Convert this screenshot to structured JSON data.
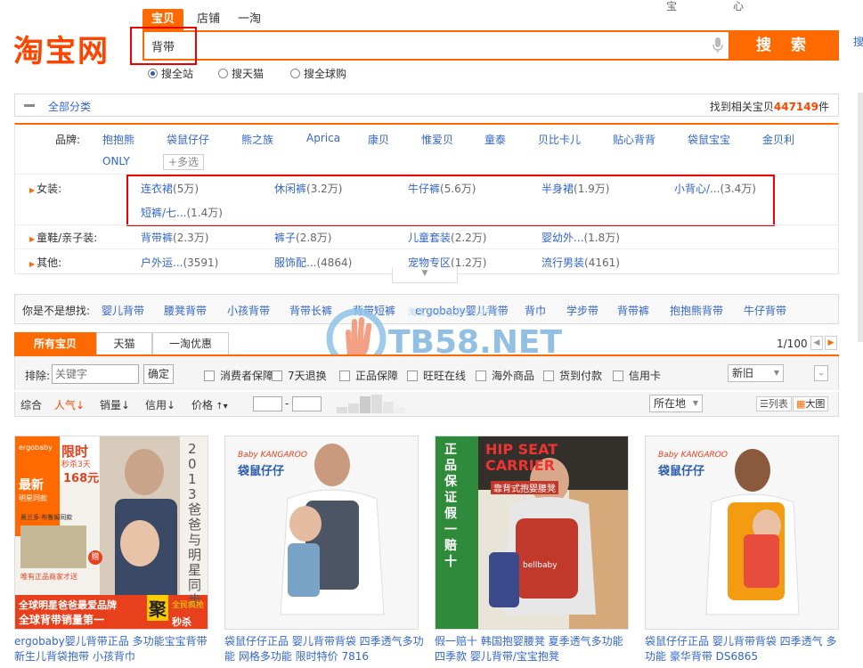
{
  "header": {
    "logo": "淘宝网",
    "top_faint_left": "宝",
    "top_faint_right": "心",
    "search_tabs": [
      "宝贝",
      "店铺",
      "一淘"
    ],
    "search_value": "背带",
    "search_button": "搜 索",
    "radios": [
      "搜全站",
      "搜天猫",
      "搜全球购"
    ],
    "right_edge_char": "搜"
  },
  "category_bar": {
    "all_label": "全部分类",
    "found_prefix": "找到相关宝贝",
    "found_count": "447149",
    "found_suffix": "件"
  },
  "filters": {
    "brand_label": "品牌:",
    "brands": [
      "抱抱熊",
      "袋鼠仔仔",
      "熊之族",
      "Aprica",
      "康贝",
      "惟爱贝",
      "童泰",
      "贝比卡儿",
      "贴心背背",
      "袋鼠宝宝",
      "金贝利",
      "ONLY"
    ],
    "more_select": "+多选",
    "rows": [
      {
        "label": "女装:",
        "items": [
          {
            "name": "连衣裙",
            "count": "(5万)"
          },
          {
            "name": "休闲裤",
            "count": "(3.2万)"
          },
          {
            "name": "牛仔裤",
            "count": "(5.6万)"
          },
          {
            "name": "半身裙",
            "count": "(1.9万)"
          },
          {
            "name": "小背心/...",
            "count": "(3.4万)"
          },
          {
            "name": "短裤/七...",
            "count": "(1.4万)"
          }
        ]
      },
      {
        "label": "童鞋/亲子装:",
        "items": [
          {
            "name": "背带裤",
            "count": "(2.3万)"
          },
          {
            "name": "裤子",
            "count": "(2.8万)"
          },
          {
            "name": "儿童套装",
            "count": "(2.2万)"
          },
          {
            "name": "婴幼外...",
            "count": "(1.8万)"
          }
        ]
      },
      {
        "label": "其他:",
        "items": [
          {
            "name": "户外运...",
            "count": "(3591)"
          },
          {
            "name": "服饰配...",
            "count": "(4864)"
          },
          {
            "name": "宠物专区",
            "count": "(1.2万)"
          },
          {
            "name": "流行男装",
            "count": "(4161)"
          }
        ]
      }
    ]
  },
  "suggest": {
    "label": "你是不是想找:",
    "items": [
      "婴儿背带",
      "腰凳背带",
      "小孩背带",
      "背带长裤",
      "背带短裤",
      "ergobaby婴儿背带",
      "背巾",
      "学步带",
      "背带裤",
      "抱抱熊背带",
      "牛仔背带"
    ]
  },
  "watermark": {
    "text": "TB58.NET",
    "sub": "淘宝卖家·运营·学习平台"
  },
  "result_tabs": [
    "所有宝贝",
    "天猫",
    "一淘优惠"
  ],
  "pager": "1/100",
  "filter_row": {
    "exclude_label": "排除:",
    "exclude_placeholder": "关键字",
    "confirm": "确定",
    "checks": [
      "消费者保障",
      "7天退换",
      "正品保障",
      "旺旺在线",
      "海外商品",
      "货到付款",
      "信用卡"
    ],
    "condition": "新旧"
  },
  "sort_row": {
    "items": [
      "综合",
      "人气",
      "销量",
      "信用",
      "价格"
    ],
    "active": "人气",
    "dash": "-",
    "location": "所在地",
    "view_list": "列表",
    "view_grid": "大图"
  },
  "products": [
    {
      "title": "ergobaby婴儿背带正品 多功能宝宝背带 新生儿背袋抱带 小孩背巾",
      "image_text": {
        "badge": "限时",
        "badge_sub": "秒杀3天",
        "price": "168元",
        "newest": "最新",
        "newest_sub": "明星同款",
        "vertical": "2013爸爸与明星同步",
        "brand": "ergobaby",
        "ad1": "全球明星爸爸最爱品牌",
        "ad2": "全球背带销量第一",
        "big": "聚",
        "big_sub": "秒杀",
        "promo": "全民疯抢",
        "gift": "赠",
        "note": "唯有正品商家才送",
        "caption": "奥兰多·布鲁姆同款"
      }
    },
    {
      "title": "袋鼠仔仔正品 婴儿背带背袋 四季透气多功能 网格多功能 限时特价 7816",
      "image_text": {
        "brand_en": "Baby KANGAROO",
        "brand_cn": "袋鼠仔仔"
      }
    },
    {
      "title": "假一赔十 韩国抱婴腰凳 夏季透气多功能 四季款 婴儿背带/宝宝抱凳",
      "image_text": {
        "side": "正品保证 假一赔十",
        "title": "HIP SEAT CARRIER",
        "sub": "靠背式抱婴腰凳",
        "brand": "bellbaby"
      }
    },
    {
      "title": "袋鼠仔仔正品 婴儿背带背袋 四季透气 多功能 豪华背带 DS6865",
      "image_text": {
        "brand_en": "Baby KANGAROO",
        "brand_cn": "袋鼠仔仔"
      }
    }
  ],
  "colors": {
    "accent": "#ff6a00",
    "link": "#3366cc",
    "highlight": "#e00000"
  }
}
